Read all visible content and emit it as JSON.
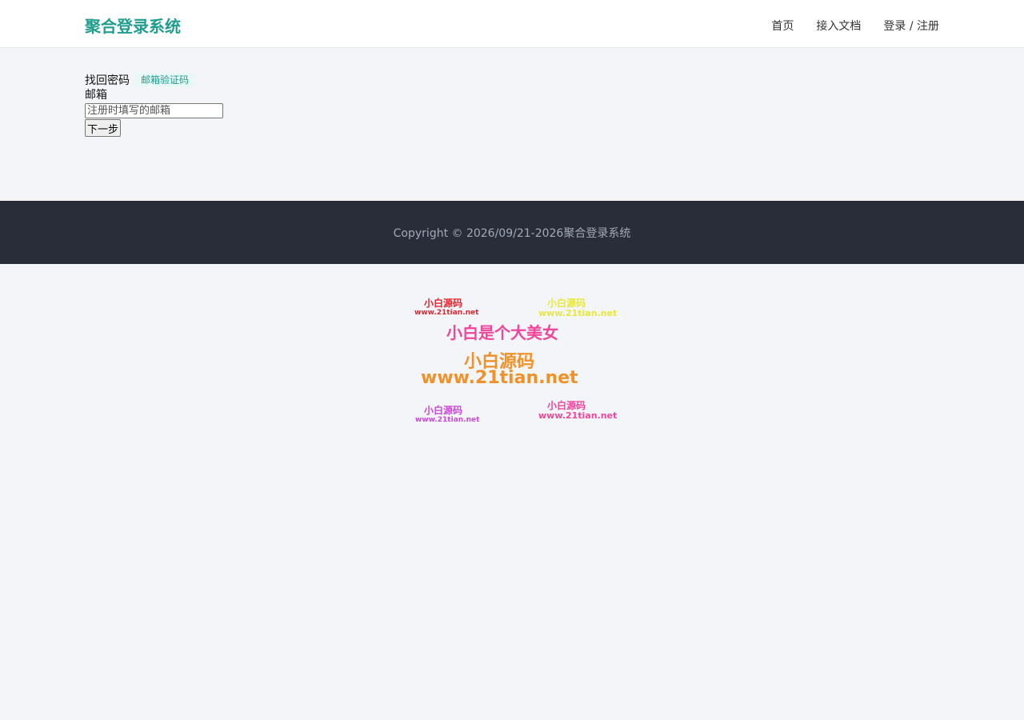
{
  "header": {
    "brand": "聚合登录系统",
    "nav": [
      "首页",
      "接入文档",
      "登录 / 注册"
    ]
  },
  "form": {
    "title": "找回密码",
    "badge": "邮箱验证码",
    "email_label": "邮箱",
    "email_placeholder": "注册时填写的邮箱",
    "email_value": "",
    "next_button": "下一步"
  },
  "footer": {
    "copyright": "Copyright © 2026/09/21-2026聚合登录系统"
  },
  "watermark": {
    "top_left_title": "小白源码",
    "top_left_url": "www.21tian.net",
    "top_right_title": "小白源码",
    "top_right_url": "www.21tian.net",
    "tagline": "小白是个大美女",
    "main_title": "小白源码",
    "main_url": "www.21tian.net",
    "bottom_left_title": "小白源码",
    "bottom_left_url": "www.21tian.net",
    "bottom_right_title": "小白源码",
    "bottom_right_url": "www.21tian.net",
    "colors": {
      "top_left": "#e0262f",
      "top_right": "#e8e83a",
      "tagline": "#f0459a",
      "main": "#f0922a",
      "bottom_left": "#c84bd6",
      "bottom_right": "#f0459a"
    }
  },
  "colors": {
    "brand": "#1f9d8f",
    "footer_bg": "#292d3a",
    "page_bg": "#f3f5f9"
  }
}
